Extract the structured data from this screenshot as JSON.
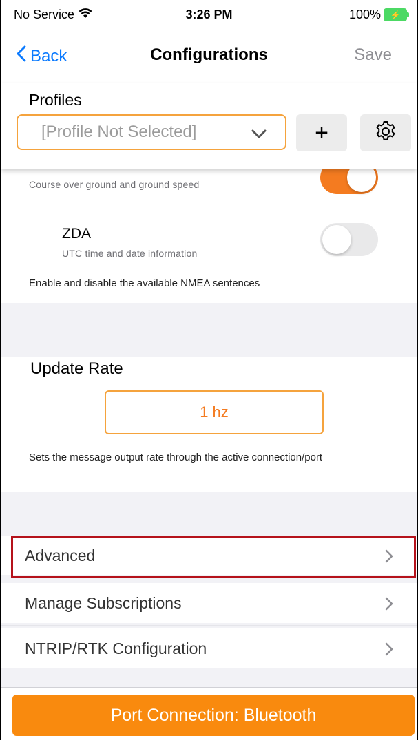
{
  "status_bar": {
    "carrier": "No Service",
    "time": "3:26 PM",
    "battery": "100%"
  },
  "nav": {
    "back_label": "Back",
    "title": "Configurations",
    "save_label": "Save"
  },
  "profiles": {
    "title": "Profiles",
    "placeholder": "[Profile Not Selected]",
    "add_label": "+"
  },
  "sentences": [
    {
      "title": "VTG",
      "subtitle": "Course over ground and ground speed",
      "enabled": true
    },
    {
      "title": "ZDA",
      "subtitle": "UTC time and date information",
      "enabled": false
    }
  ],
  "sentences_note": "Enable and disable the available NMEA sentences",
  "update_rate": {
    "title": "Update Rate",
    "value": "1 hz",
    "note": "Sets the message output rate through the active connection/port"
  },
  "menu": [
    {
      "label": "Advanced"
    },
    {
      "label": "Manage Subscriptions"
    },
    {
      "label": "NTRIP/RTK Configuration"
    }
  ],
  "port_button": "Port Connection: Bluetooth",
  "colors": {
    "accent": "#f47b20",
    "link": "#0a7aff",
    "highlight": "#b5121b",
    "battery": "#4cd964"
  }
}
